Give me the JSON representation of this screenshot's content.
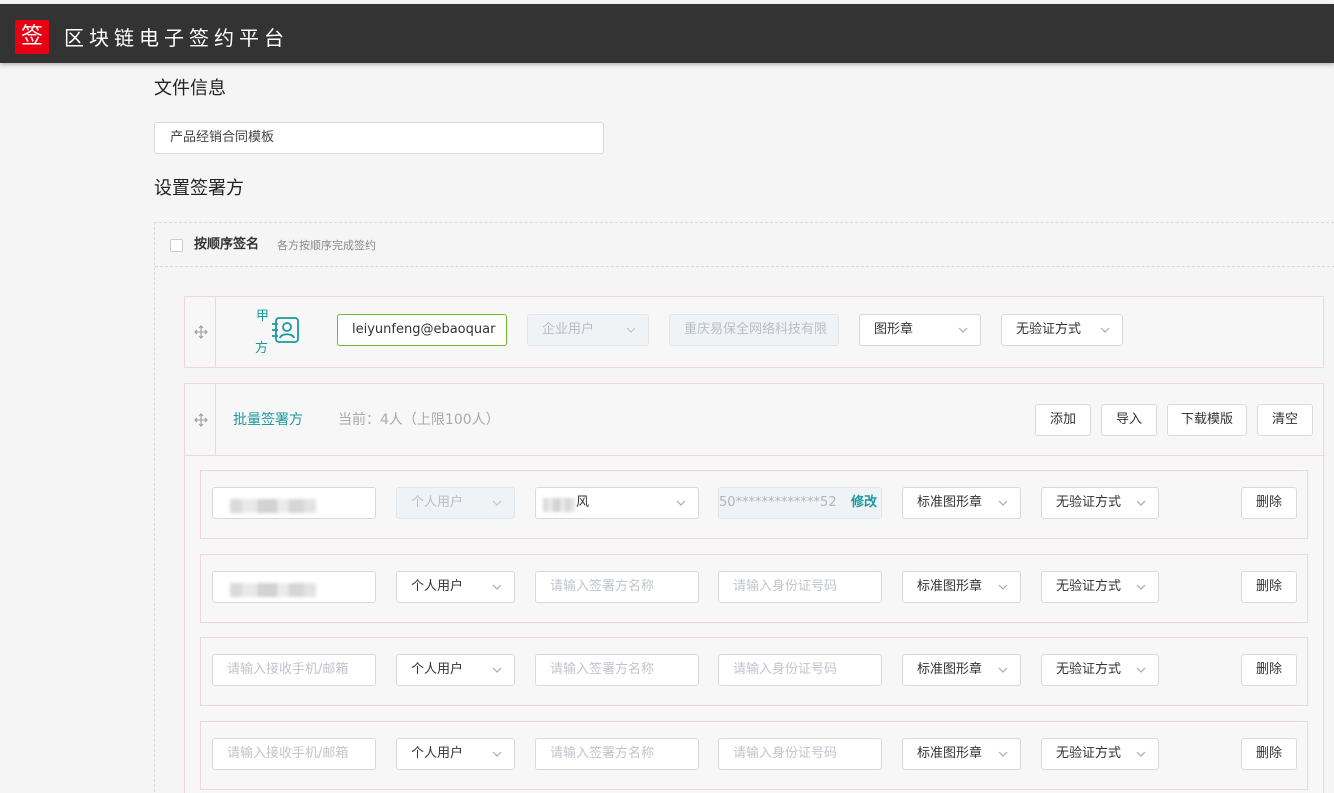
{
  "header": {
    "logo_char": "签",
    "title": "区块链电子签约平台"
  },
  "doc_info": {
    "section_title": "文件信息",
    "file_name": "产品经销合同模板"
  },
  "signers": {
    "section_title": "设置签署方",
    "order_sign_label": "按顺序签名",
    "order_sign_hint": "各方按顺序完成签约",
    "order_sign_checked": false
  },
  "party_a": {
    "label_top": "甲",
    "label_bottom": "方",
    "email": "leiyunfeng@ebaoquar",
    "user_type": "企业用户",
    "company": "重庆易保全网络科技有限",
    "seal_type": "图形章",
    "verify": "无验证方式"
  },
  "batch": {
    "title": "批量签署方",
    "count_text": "当前：4人（上限100人）",
    "add_label": "添加",
    "import_label": "导入",
    "download_label": "下载模版",
    "clear_label": "清空",
    "rows": [
      {
        "contact_value": "",
        "user_type": "个人用户",
        "name_value": "风",
        "id_value": "50*************52",
        "edit_label": "修改",
        "seal_type": "标准图形章",
        "verify": "无验证方式",
        "delete_label": "删除"
      },
      {
        "contact_value": "",
        "user_type": "个人用户",
        "name_placeholder": "请输入签署方名称",
        "id_placeholder": "请输入身份证号码",
        "seal_type": "标准图形章",
        "verify": "无验证方式",
        "delete_label": "删除"
      },
      {
        "contact_placeholder": "请输入接收手机/邮箱",
        "user_type": "个人用户",
        "name_placeholder": "请输入签署方名称",
        "id_placeholder": "请输入身份证号码",
        "seal_type": "标准图形章",
        "verify": "无验证方式",
        "delete_label": "删除"
      },
      {
        "contact_placeholder": "请输入接收手机/邮箱",
        "user_type": "个人用户",
        "name_placeholder": "请输入签署方名称",
        "id_placeholder": "请输入身份证号码",
        "seal_type": "标准图形章",
        "verify": "无验证方式",
        "delete_label": "删除"
      }
    ]
  },
  "colors": {
    "topbar": "#333333",
    "logo_red": "#e60012",
    "accent_teal": "#1a9aa0",
    "active_green": "#6fba2c",
    "card_border": "#f3d5d9"
  },
  "icons": [
    "drag-handle-icon",
    "contact-card-icon",
    "chevron-down-icon"
  ]
}
